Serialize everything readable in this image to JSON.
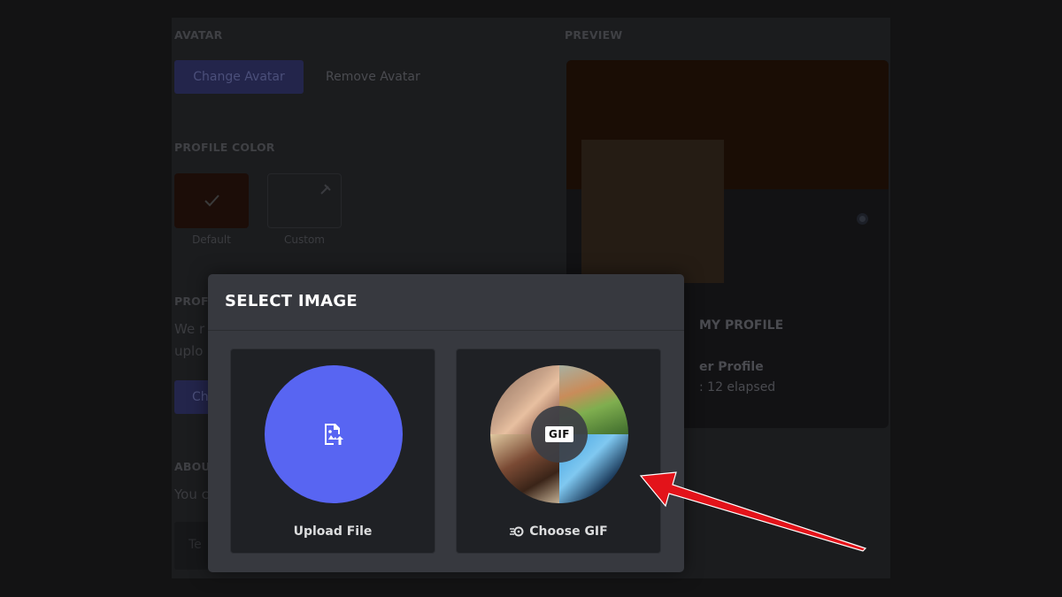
{
  "settings": {
    "avatar_section": "AVATAR",
    "change_avatar": "Change Avatar",
    "remove_avatar": "Remove Avatar",
    "profile_color_section": "PROFILE COLOR",
    "swatch_default": "Default",
    "swatch_custom": "Custom",
    "profile_banner_partial": "PROF",
    "banner_desc_1": "We r",
    "banner_desc_2": "uplo",
    "banner_btn_partial": "Ch",
    "about_partial": "ABOU",
    "about_desc_partial": "You c",
    "textarea_partial": "Te"
  },
  "preview": {
    "section": "PREVIEW",
    "my_profile": "MY PROFILE",
    "activity_title": "er Profile",
    "activity_time": ": 12 elapsed"
  },
  "modal": {
    "title": "SELECT IMAGE",
    "upload_label": "Upload File",
    "gif_label": "Choose GIF",
    "gif_badge": "GIF"
  },
  "colors": {
    "accent": "#5865f2",
    "modal_bg": "#37393f",
    "card_bg": "#1f2125",
    "arrow": "#e3131a"
  },
  "icons": {
    "upload": "image-upload-icon",
    "gif_search": "gif-search-icon",
    "check": "check-icon",
    "eyedropper": "eyedropper-icon"
  }
}
